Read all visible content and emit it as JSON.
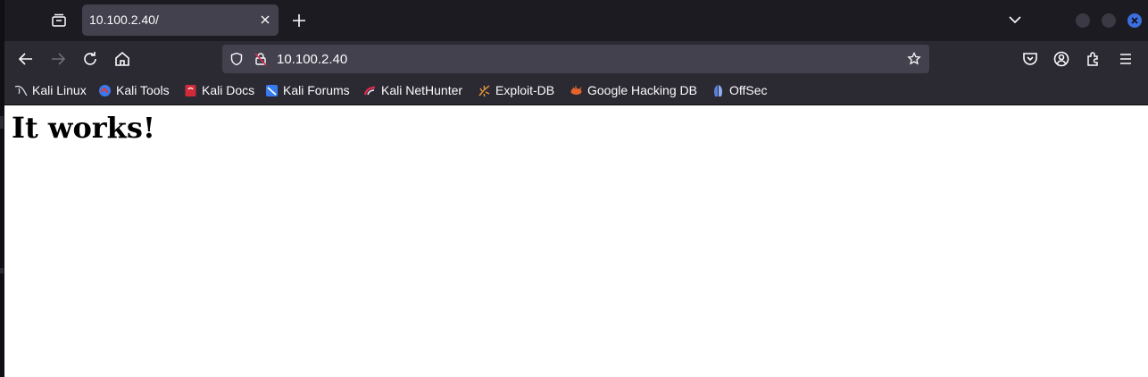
{
  "tab": {
    "title": "10.100.2.40/"
  },
  "address_bar": {
    "url": "10.100.2.40"
  },
  "bookmarks": [
    {
      "label": "Kali Linux",
      "icon": "kali-dragon-icon"
    },
    {
      "label": "Kali Tools",
      "icon": "kali-tools-icon"
    },
    {
      "label": "Kali Docs",
      "icon": "kali-docs-icon"
    },
    {
      "label": "Kali Forums",
      "icon": "kali-forums-icon"
    },
    {
      "label": "Kali NetHunter",
      "icon": "kali-nethunter-icon"
    },
    {
      "label": "Exploit-DB",
      "icon": "exploit-db-icon"
    },
    {
      "label": "Google Hacking DB",
      "icon": "google-hacking-db-icon"
    },
    {
      "label": "OffSec",
      "icon": "offsec-icon"
    }
  ],
  "page": {
    "heading": "It works!"
  },
  "colors": {
    "window_close": "#3b6fe0",
    "toolbar": "#2b2a33",
    "tabbar": "#1c1b22",
    "urlbar": "#42414d"
  }
}
